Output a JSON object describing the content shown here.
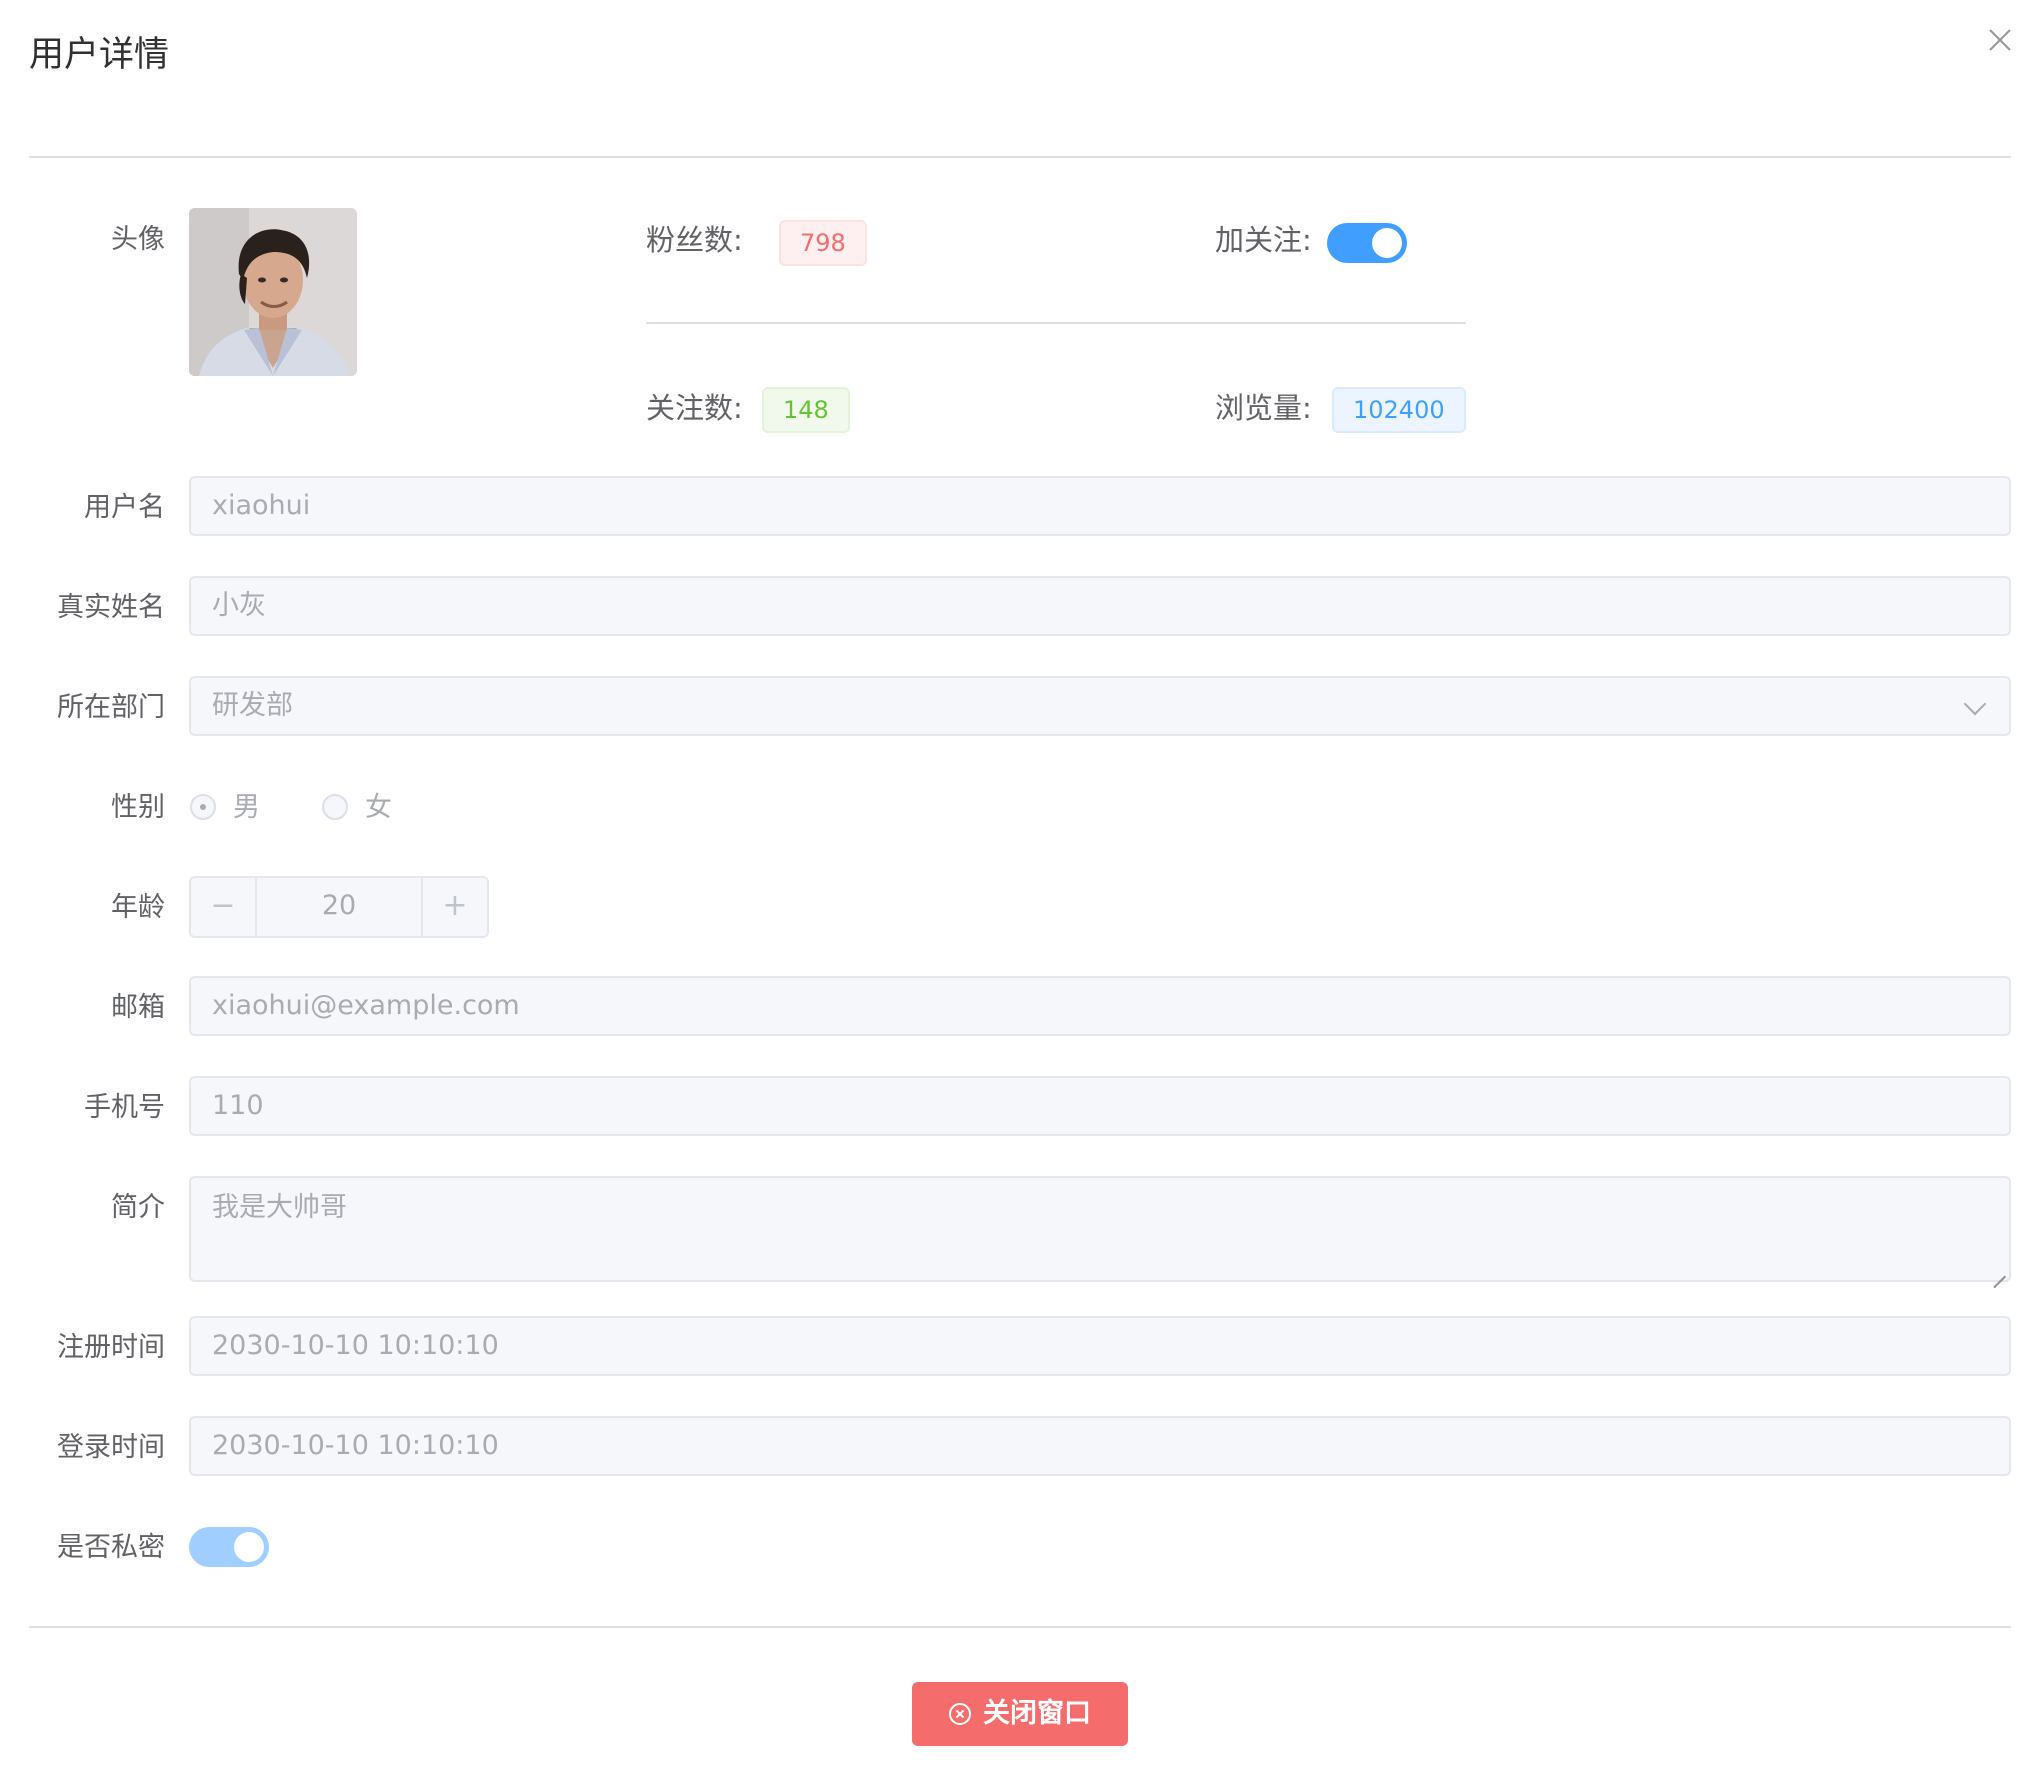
{
  "dialog": {
    "title": "用户详情",
    "close_button": "×",
    "footer_button": "关闭窗口"
  },
  "avatar": {
    "label": "头像"
  },
  "stats": {
    "fans_label": "粉丝数:",
    "fans_value": "798",
    "follow_label": "加关注:",
    "follow_on": true,
    "following_label": "关注数:",
    "following_value": "148",
    "views_label": "浏览量:",
    "views_value": "102400"
  },
  "form": {
    "username": {
      "label": "用户名",
      "value": "xiaohui"
    },
    "realname": {
      "label": "真实姓名",
      "value": "小灰"
    },
    "department": {
      "label": "所在部门",
      "value": "研发部"
    },
    "gender": {
      "label": "性别",
      "options": [
        "男",
        "女"
      ],
      "selected": "男"
    },
    "age": {
      "label": "年龄",
      "value": "20",
      "minus": "−",
      "plus": "+"
    },
    "email": {
      "label": "邮箱",
      "value": "xiaohui@example.com"
    },
    "phone": {
      "label": "手机号",
      "value": "110"
    },
    "bio": {
      "label": "简介",
      "value": "我是大帅哥"
    },
    "register_time": {
      "label": "注册时间",
      "value": "2030-10-10 10:10:10"
    },
    "login_time": {
      "label": "登录时间",
      "value": "2030-10-10 10:10:10"
    },
    "private": {
      "label": "是否私密",
      "on": true
    }
  },
  "colors": {
    "primary": "#409eff",
    "primary_disabled": "#a0cfff",
    "danger": "#f56c6c",
    "success": "#67c23a"
  }
}
